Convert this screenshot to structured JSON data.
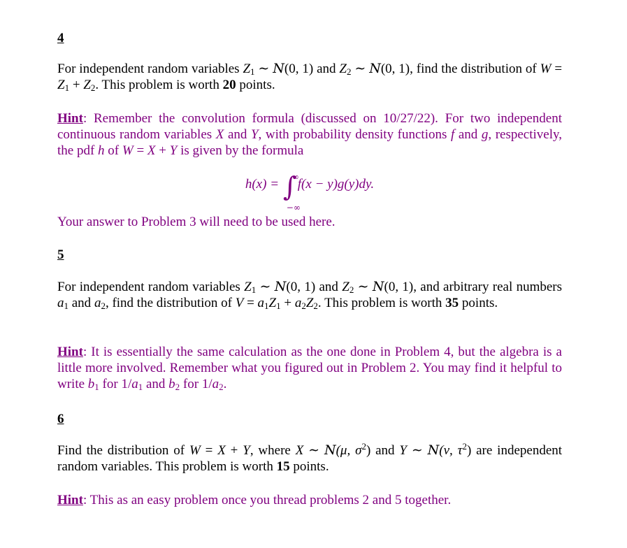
{
  "colors": {
    "text": "#000000",
    "hint": "#800080"
  },
  "problems": [
    {
      "number": "4",
      "statement": {
        "t1": "For independent random variables ",
        "z1": "Z",
        "s1": "1",
        "tilde1": " ∼ ",
        "n1": "N",
        "args1": "(0, 1)",
        "and1": " and ",
        "z2": "Z",
        "s2": "2",
        "tilde2": " ∼ ",
        "n2": "N",
        "args2": "(0, 1)",
        "t2": ", find the distribution of ",
        "w": "W",
        "eq": " = ",
        "z3": "Z",
        "s3": "1",
        "plus": " + ",
        "z4": "Z",
        "s4": "2",
        "t3": ". This problem is worth ",
        "points": "20",
        "t4": " points."
      },
      "hint": {
        "label": "Hint",
        "t1": ": Remember the convolution formula (discussed on 10/27/22). For two independent continuous random variables ",
        "x": "X",
        "and1": " and ",
        "y": "Y",
        "t2": ", with probability density functions ",
        "f": "f",
        "and2": " and ",
        "g": "g",
        "t3": ", respectively, the pdf ",
        "h": "h",
        "t4": " of ",
        "w": "W",
        "eq": " = ",
        "x2": "X",
        "plus": " + ",
        "y2": "Y",
        "t5": " is given by the formula"
      },
      "formula": {
        "lhs": "h(x) = ",
        "integral": "∫",
        "upper": "∞",
        "lower": "−∞",
        "rhs": "f(x − y)g(y)dy."
      },
      "note": "Your answer to Problem 3 will need to be used here."
    },
    {
      "number": "5",
      "statement": {
        "t1": "For independent random variables ",
        "z1": "Z",
        "s1": "1",
        "tilde1": " ∼ ",
        "n1": "N",
        "args1": "(0, 1)",
        "and1": " and ",
        "z2": "Z",
        "s2": "2",
        "tilde2": " ∼ ",
        "n2": "N",
        "args2": "(0, 1)",
        "t2": ", and arbitrary real numbers ",
        "a1": "a",
        "as1": "1",
        "and2": " and ",
        "a2": "a",
        "as2": "2",
        "t3": ", find the distribution of ",
        "v": "V",
        "eq": " = ",
        "a3": "a",
        "as3": "1",
        "z3": "Z",
        "s3": "1",
        "plus": " + ",
        "a4": "a",
        "as4": "2",
        "z4": "Z",
        "s4": "2",
        "t4": ". This problem is worth ",
        "points": "35",
        "t5": " points."
      },
      "hint": {
        "label": "Hint",
        "t1": ": It is essentially the same calculation as the one done in Problem 4, but the algebra is a little more involved. Remember what you figured out in Problem 2. You may find it helpful to write ",
        "b1": "b",
        "bs1": "1",
        "for1": " for 1/",
        "a1": "a",
        "as1": "1",
        "and1": " and ",
        "b2": "b",
        "bs2": "2",
        "for2": " for 1/",
        "a2": "a",
        "as2": "2",
        "end": "."
      }
    },
    {
      "number": "6",
      "statement": {
        "t1": "Find the distribution of ",
        "w": "W",
        "eq": " = ",
        "x": "X",
        "plus": " + ",
        "y": "Y",
        "t2": ", where ",
        "x2": "X",
        "tilde1": " ∼ ",
        "n1": "N",
        "args1a": "(μ, σ",
        "sq1": "2",
        "args1b": ")",
        "and1": " and ",
        "y2": "Y",
        "tilde2": " ∼ ",
        "n2": "N",
        "args2a": "(ν, τ",
        "sq2": "2",
        "args2b": ")",
        "t3": " are independent random variables. This problem is worth ",
        "points": "15",
        "t4": " points."
      },
      "hint": {
        "label": "Hint",
        "text": ": This as an easy problem once you thread problems 2 and 5 together."
      }
    }
  ]
}
